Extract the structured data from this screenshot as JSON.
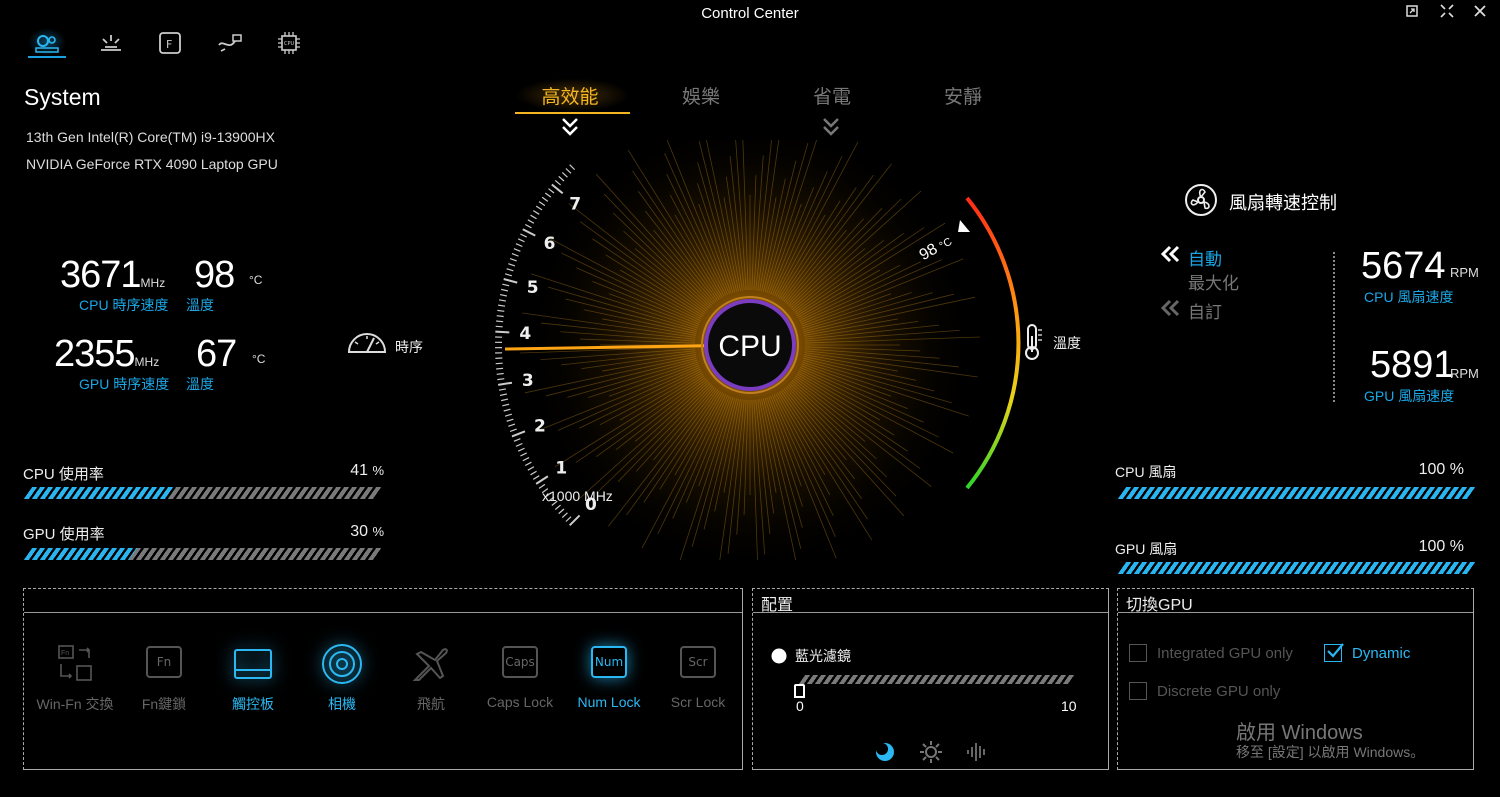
{
  "window": {
    "title": "Control Center",
    "buttons": [
      "restore-icon",
      "compact-icon",
      "close-icon"
    ]
  },
  "nav": {
    "icons": [
      "system-settings-icon",
      "lighting-icon",
      "fn-key-icon",
      "hdmi-cable-icon",
      "cpu-chip-icon"
    ],
    "active_index": 0
  },
  "system": {
    "title": "System",
    "cpu_name": "13th Gen Intel(R) Core(TM) i9-13900HX",
    "gpu_name": "NVIDIA GeForce RTX 4090 Laptop GPU"
  },
  "stats": {
    "cpu_clock": "3671",
    "cpu_clock_unit": "MHz",
    "cpu_clock_label": "CPU 時序速度",
    "cpu_temp": "98",
    "cpu_temp_unit": "°C",
    "cpu_temp_label": "溫度",
    "gpu_clock": "2355",
    "gpu_clock_unit": "MHz",
    "gpu_clock_label": "GPU 時序速度",
    "gpu_temp": "67",
    "gpu_temp_unit": "°C",
    "gpu_temp_label": "溫度"
  },
  "usage": {
    "cpu_label": "CPU 使用率",
    "cpu_value": "41",
    "cpu_fraction": 0.41,
    "gpu_label": "GPU 使用率",
    "gpu_value": "30",
    "gpu_fraction": 0.3,
    "pct": "%"
  },
  "modes": {
    "tabs": [
      "高效能",
      "娛樂",
      "省電",
      "安靜"
    ],
    "active_index": 0
  },
  "gauge": {
    "center_label": "CPU",
    "clock_label": "時序",
    "temp_label": "溫度",
    "temp_value": "98",
    "temp_unit": "°C",
    "scale_unit": "x1000 MHz",
    "ticks": [
      "0",
      "1",
      "2",
      "3",
      "4",
      "5",
      "6",
      "7"
    ],
    "needle_value": 3.671
  },
  "fan": {
    "title": "風扇轉速控制",
    "options": [
      "自動",
      "最大化",
      "自訂"
    ],
    "active_index": 0,
    "cpu_rpm": "5674",
    "cpu_rpm_label": "CPU 風扇速度",
    "gpu_rpm": "5891",
    "gpu_rpm_label": "GPU 風扇速度",
    "rpm_unit": "RPM",
    "cpu_fan_label": "CPU 風扇",
    "cpu_fan_value": "100",
    "cpu_fan_fraction": 1.0,
    "gpu_fan_label": "GPU 風扇",
    "gpu_fan_value": "100",
    "gpu_fan_fraction": 1.0,
    "pct": "%"
  },
  "keys": [
    {
      "label": "Win-Fn 交換",
      "icon": "win-fn-swap-icon",
      "on": false
    },
    {
      "label": "Fn鍵鎖",
      "icon": "fn-lock-icon",
      "cap": "Fn",
      "on": false
    },
    {
      "label": "觸控板",
      "icon": "touchpad-icon",
      "on": true
    },
    {
      "label": "相機",
      "icon": "camera-icon",
      "on": true
    },
    {
      "label": "飛航",
      "icon": "airplane-icon",
      "on": false
    },
    {
      "label": "Caps Lock",
      "icon": "caps-lock-icon",
      "cap": "Caps",
      "on": false
    },
    {
      "label": "Num Lock",
      "icon": "num-lock-icon",
      "cap": "Num",
      "on": true
    },
    {
      "label": "Scr Lock",
      "icon": "scroll-lock-icon",
      "cap": "Scr",
      "on": false
    }
  ],
  "config": {
    "title": "配置",
    "blue_light_label": "藍光濾鏡",
    "slider_min": "0",
    "slider_max": "10",
    "slider_value": 0
  },
  "gpu_switch": {
    "title": "切換GPU",
    "integrated": "Integrated GPU only",
    "dynamic": "Dynamic",
    "discrete": "Discrete GPU only",
    "selected": "Dynamic",
    "activate_title": "啟用 Windows",
    "activate_sub": "移至 [設定] 以啟用 Windows。"
  },
  "colors": {
    "accent": "#1aa7e6",
    "mode_active": "#f3b521",
    "temp_arc_hot": "#ff2a1a",
    "temp_arc_cool": "#2bd52b"
  }
}
